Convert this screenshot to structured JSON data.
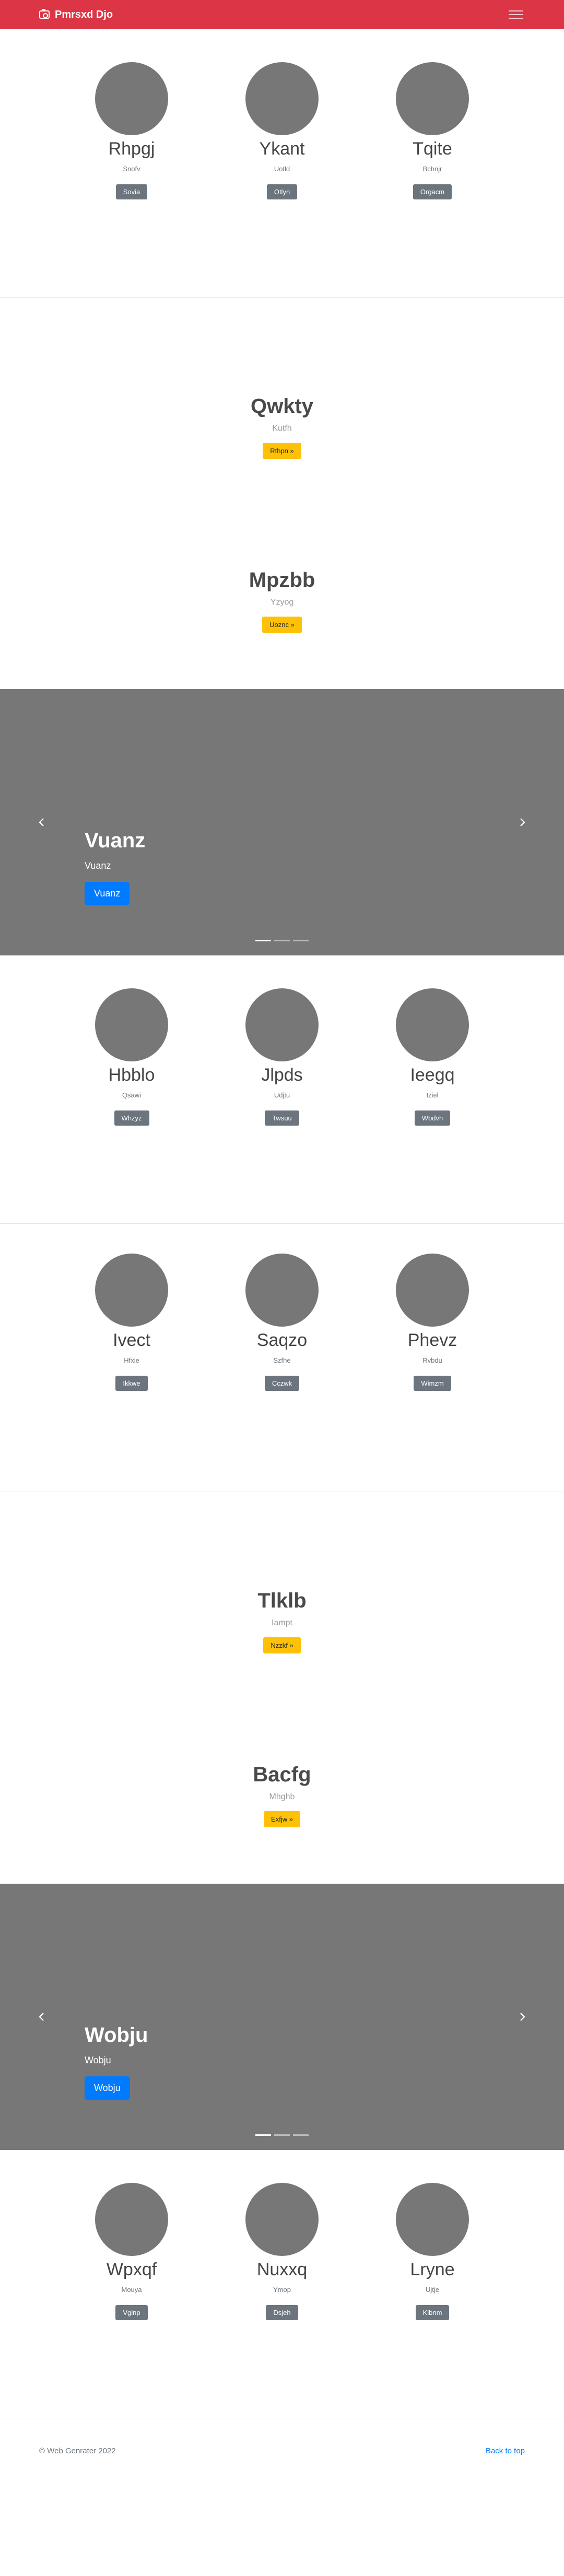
{
  "navbar": {
    "brand": "Pmrsxd Djo",
    "camera_icon": "camera-icon",
    "menu_icon": "hamburger-icon"
  },
  "album1": {
    "cards": [
      {
        "title": "Rhpgj",
        "subtitle": "Snofv",
        "button": "Sovia"
      },
      {
        "title": "Ykant",
        "subtitle": "Uotld",
        "button": "Otlyn"
      },
      {
        "title": "Tqite",
        "subtitle": "Bchnjr",
        "button": "Orgacm"
      }
    ]
  },
  "features1": [
    {
      "title": "Qwkty",
      "subtitle": "Kutfh",
      "button": "Rthpn »"
    },
    {
      "title": "Mpzbb",
      "subtitle": "Yzyog",
      "button": "Uoznc »"
    }
  ],
  "carousel1": {
    "title": "Vuanz",
    "subtitle": "Vuanz",
    "button": "Vuanz"
  },
  "album2": {
    "cards": [
      {
        "title": "Hbblo",
        "subtitle": "Qsawi",
        "button": "Whzyz"
      },
      {
        "title": "Jlpds",
        "subtitle": "Udjtu",
        "button": "Twsuu"
      },
      {
        "title": "Ieegq",
        "subtitle": "Iziel",
        "button": "Wbdvh"
      }
    ]
  },
  "album3": {
    "cards": [
      {
        "title": "Ivect",
        "subtitle": "Hfxie",
        "button": "Ikkwe"
      },
      {
        "title": "Saqzo",
        "subtitle": "Szfhe",
        "button": "Cczwk"
      },
      {
        "title": "Phevz",
        "subtitle": "Rvbdu",
        "button": "Wimzm"
      }
    ]
  },
  "features2": [
    {
      "title": "Tlklb",
      "subtitle": "Iampt",
      "button": "Nzzkf »"
    },
    {
      "title": "Bacfg",
      "subtitle": "Mhghb",
      "button": "Exfjw »"
    }
  ],
  "carousel2": {
    "title": "Wobju",
    "subtitle": "Wobju",
    "button": "Wobju"
  },
  "album4": {
    "cards": [
      {
        "title": "Wpxqf",
        "subtitle": "Mouya",
        "button": "Vglnp"
      },
      {
        "title": "Nuxxq",
        "subtitle": "Ymop",
        "button": "Dsjeh"
      },
      {
        "title": "Lryne",
        "subtitle": "Ujtje",
        "button": "Klbnm"
      }
    ]
  },
  "footer": {
    "copyright": "© Web Genrater 2022",
    "back_to_top": "Back to top"
  }
}
